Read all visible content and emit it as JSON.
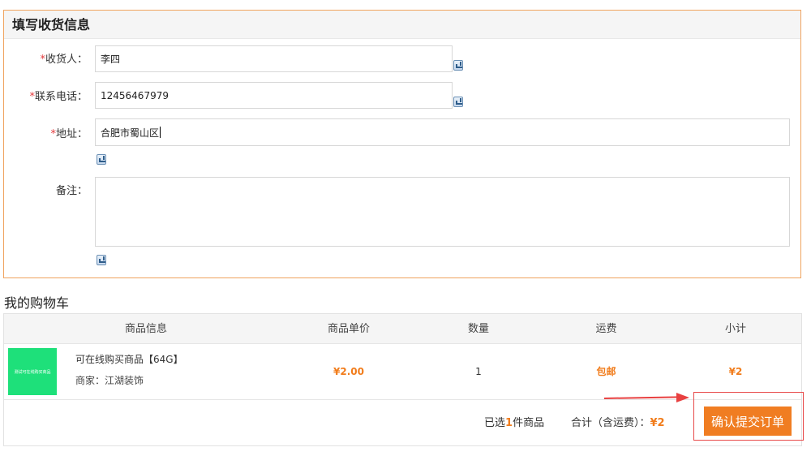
{
  "shipping": {
    "title": "填写收货信息",
    "required_mark": "*",
    "name_label": "收货人：",
    "name_value": "李四",
    "phone_label": "联系电话：",
    "phone_value": "12456467979",
    "address_label": "地址：",
    "address_value": "合肥市蜀山区",
    "note_label": "备注：",
    "note_value": ""
  },
  "cart": {
    "title": "我的购物车",
    "headers": [
      "商品信息",
      "商品单价",
      "数量",
      "运费",
      "小计"
    ],
    "items": [
      {
        "thumb_text": "测试可在线购买商品",
        "name": "可在线购买商品【64G】",
        "shop": "商家：江湖装饰",
        "price": "¥2.00",
        "qty": "1",
        "shipping": "包邮",
        "subtotal": "¥2"
      }
    ],
    "summary": {
      "selected_prefix": "已选",
      "selected_count": "1",
      "selected_suffix": "件商品",
      "total_label": "合计（含运费）：",
      "total_value": "¥2"
    },
    "submit_label": "确认提交订单"
  },
  "icon_names": [
    "keyboard-icon"
  ],
  "colors": {
    "accent": "#f07d22",
    "panel_border": "#f0a35e",
    "required": "#e4393c",
    "annotation": "#e84040",
    "thumb": "#1ee07a"
  }
}
